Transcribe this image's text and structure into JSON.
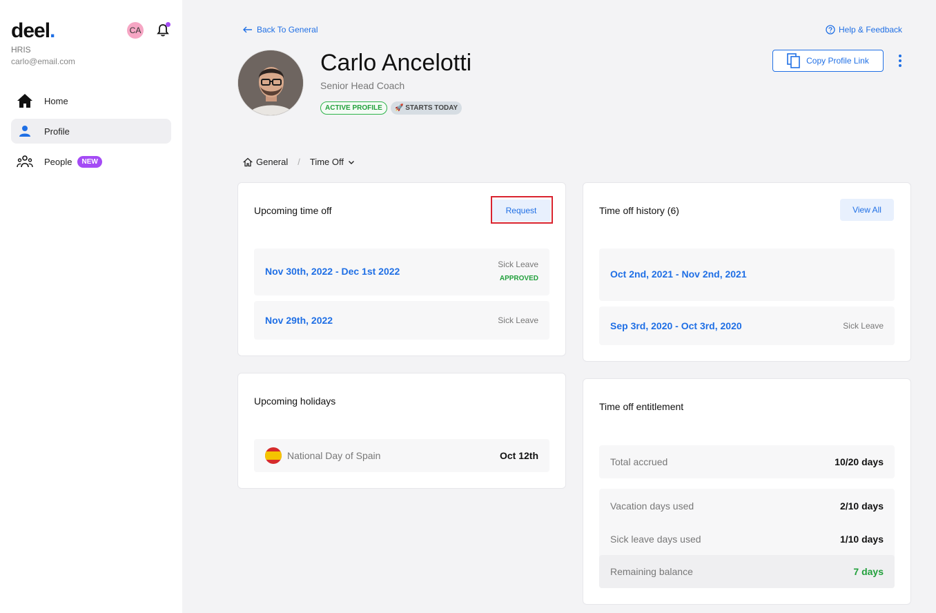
{
  "sidebar": {
    "logo": "deel",
    "logo_dot": ".",
    "org": "HRIS",
    "email": "carlo@email.com",
    "avatar_initials": "CA",
    "nav": [
      {
        "label": "Home",
        "icon": "home-icon"
      },
      {
        "label": "Profile",
        "icon": "user-icon"
      },
      {
        "label": "People",
        "icon": "people-icon",
        "badge": "NEW"
      }
    ]
  },
  "header": {
    "back_label": "Back To General",
    "help_label": "Help & Feedback",
    "name": "Carlo Ancelotti",
    "role": "Senior Head Coach",
    "tag_active": "ACTIVE PROFILE",
    "tag_start": "🚀 STARTS TODAY",
    "copy_label": "Copy Profile Link"
  },
  "breadcrumb": {
    "root": "General",
    "separator": "/",
    "current": "Time Off"
  },
  "upcoming": {
    "title": "Upcoming time off",
    "request_label": "Request",
    "items": [
      {
        "date": "Nov 30th, 2022 - Dec 1st 2022",
        "type": "Sick Leave",
        "status": "APPROVED"
      },
      {
        "date": "Nov 29th, 2022",
        "type": "Sick Leave"
      }
    ]
  },
  "history": {
    "title": "Time off history (6)",
    "view_all_label": "View All",
    "items": [
      {
        "date": "Oct 2nd, 2021 - Nov 2nd, 2021"
      },
      {
        "date": "Sep 3rd, 2020 - Oct 3rd, 2020",
        "type": "Sick Leave"
      }
    ]
  },
  "holidays": {
    "title": "Upcoming holidays",
    "items": [
      {
        "name": "National Day of Spain",
        "date": "Oct 12th",
        "flag": "spain-flag-icon"
      }
    ]
  },
  "entitlement": {
    "title": "Time off entitlement",
    "rows": [
      {
        "label": "Total accrued",
        "value": "10/20 days"
      },
      {
        "label": "Vacation days used",
        "value": "2/10 days"
      },
      {
        "label": "Sick leave days used",
        "value": "1/10 days"
      },
      {
        "label": "Remaining balance",
        "value": "7 days"
      }
    ]
  },
  "colors": {
    "accent": "#1f6fe5",
    "success": "#22a03c",
    "badge_purple": "#a44bf5",
    "highlight_red": "#d9232e"
  }
}
